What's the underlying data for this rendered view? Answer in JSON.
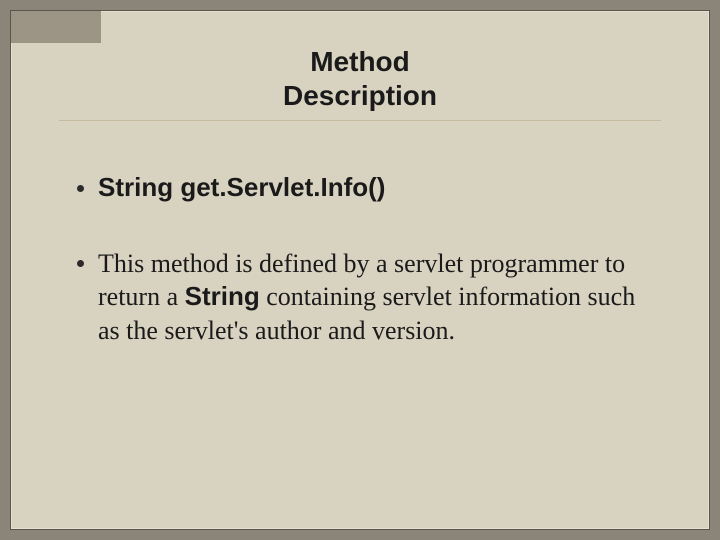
{
  "title": {
    "line1": "Method",
    "line2": "Description"
  },
  "bullets": {
    "b1": "String get.Servlet.Info()",
    "b2_pre": "This method is defined by a servlet programmer to return a ",
    "b2_bold": "String",
    "b2_post": " containing servlet information such as the servlet's author and version."
  }
}
